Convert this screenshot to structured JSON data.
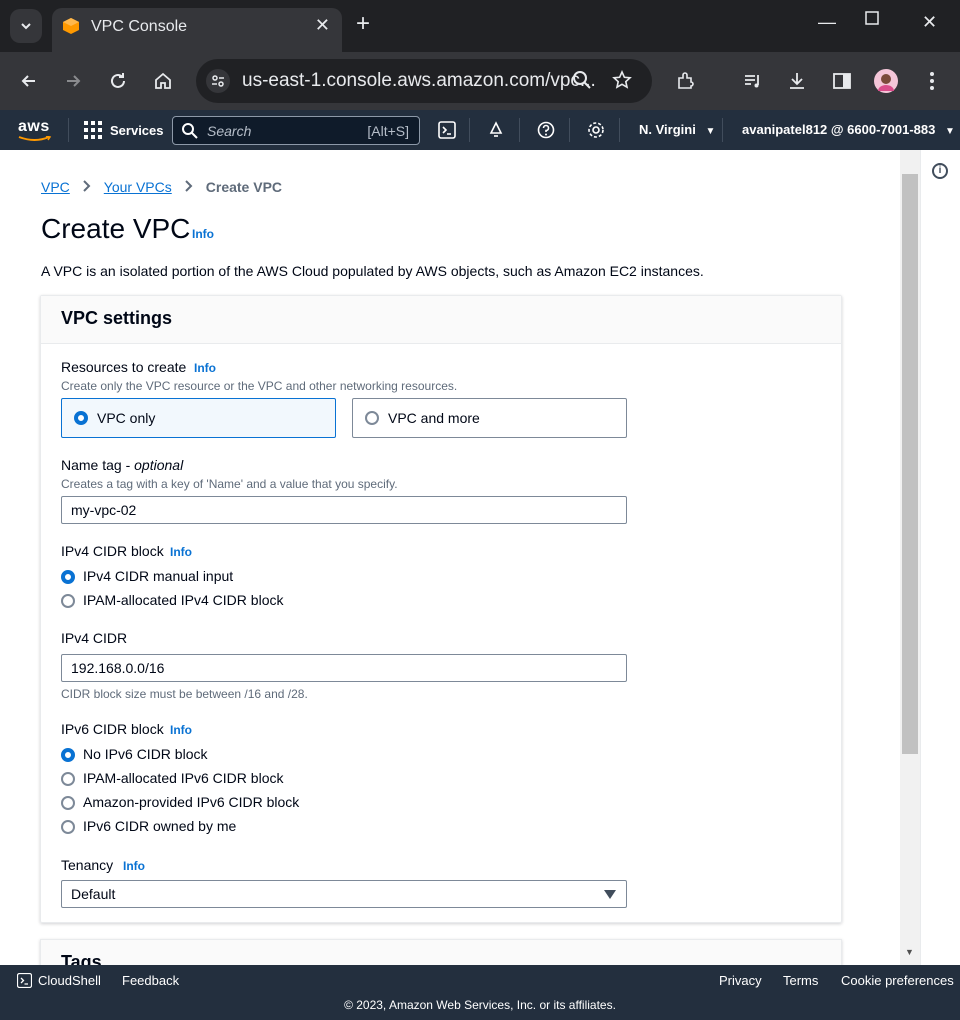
{
  "browser": {
    "tab_title": "VPC Console",
    "url": "us-east-1.console.aws.amazon.com/vpc..."
  },
  "aws_nav": {
    "logo": "aws",
    "services_label": "Services",
    "search_placeholder": "Search",
    "search_shortcut": "[Alt+S]",
    "region": "N. Virgini",
    "account": "avanipatel812 @ 6600-7001-883"
  },
  "breadcrumb": {
    "items": [
      "VPC",
      "Your VPCs"
    ],
    "current": "Create VPC"
  },
  "page": {
    "title": "Create VPC",
    "info_label": "Info",
    "description": "A VPC is an isolated portion of the AWS Cloud populated by AWS objects, such as Amazon EC2 instances."
  },
  "vpc_settings": {
    "panel_title": "VPC settings",
    "resources": {
      "label": "Resources to create",
      "info": "Info",
      "description": "Create only the VPC resource or the VPC and other networking resources.",
      "options": [
        "VPC only",
        "VPC and more"
      ],
      "selected": "VPC only"
    },
    "name_tag": {
      "label": "Name tag - ",
      "optional": "optional",
      "description": "Creates a tag with a key of 'Name' and a value that you specify.",
      "value": "my-vpc-02"
    },
    "ipv4_block": {
      "label": "IPv4 CIDR block",
      "info": "Info",
      "options": [
        "IPv4 CIDR manual input",
        "IPAM-allocated IPv4 CIDR block"
      ],
      "selected": "IPv4 CIDR manual input"
    },
    "ipv4_cidr": {
      "label": "IPv4 CIDR",
      "value": "192.168.0.0/16",
      "constraint": "CIDR block size must be between /16 and /28."
    },
    "ipv6_block": {
      "label": "IPv6 CIDR block",
      "info": "Info",
      "options": [
        "No IPv6 CIDR block",
        "IPAM-allocated IPv6 CIDR block",
        "Amazon-provided IPv6 CIDR block",
        "IPv6 CIDR owned by me"
      ],
      "selected": "No IPv6 CIDR block"
    },
    "tenancy": {
      "label": "Tenancy",
      "info": "Info",
      "value": "Default"
    }
  },
  "tags_panel": {
    "title": "Tags"
  },
  "footer": {
    "cloudshell": "CloudShell",
    "feedback": "Feedback",
    "privacy": "Privacy",
    "terms": "Terms",
    "cookie": "Cookie preferences",
    "copyright": "© 2023, Amazon Web Services, Inc. or its affiliates."
  },
  "colors": {
    "aws_nav_bg": "#232f3e",
    "link": "#0972d3",
    "selected_tile_bg": "#f2f8fd",
    "aws_orange": "#ff9900"
  }
}
